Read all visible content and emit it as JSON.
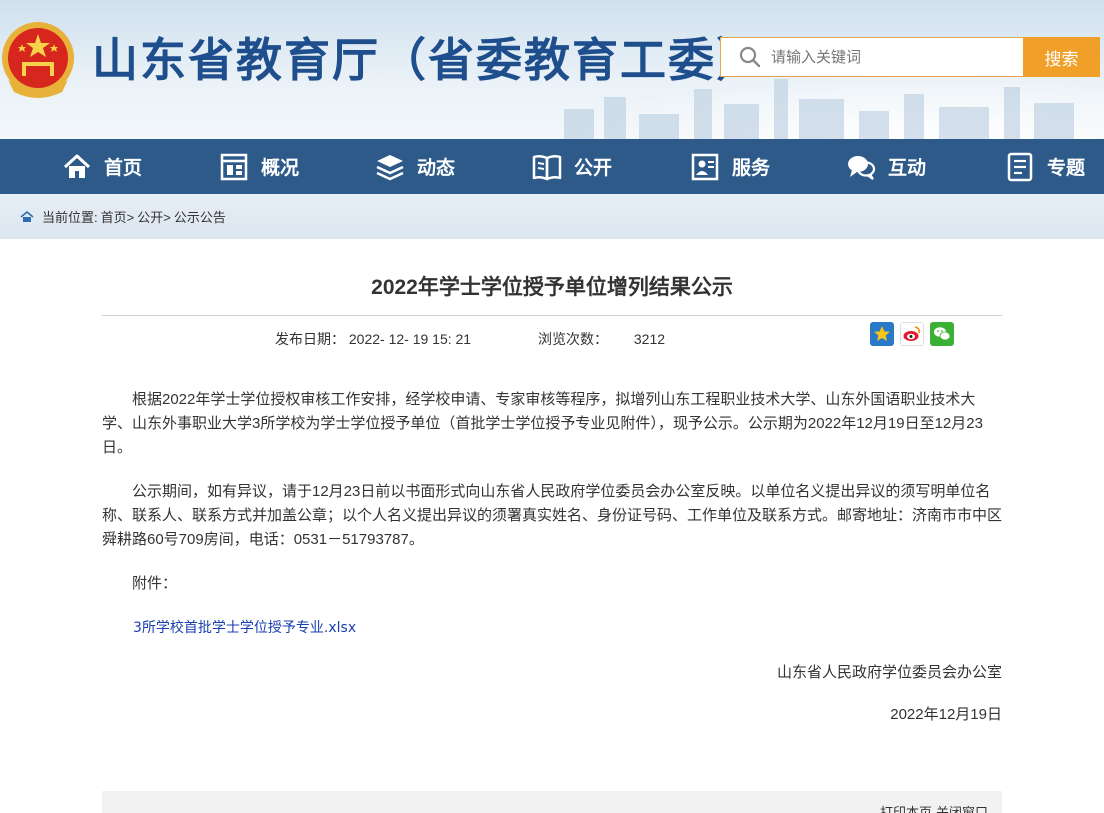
{
  "header": {
    "site_title": "山东省教育厅（省委教育工委）",
    "search_placeholder": "请输入关键词",
    "search_button": "搜索"
  },
  "nav": {
    "items": [
      {
        "label": "首页",
        "icon": "home-icon"
      },
      {
        "label": "概况",
        "icon": "overview-icon"
      },
      {
        "label": "动态",
        "icon": "news-icon"
      },
      {
        "label": "公开",
        "icon": "book-icon"
      },
      {
        "label": "服务",
        "icon": "service-icon"
      },
      {
        "label": "互动",
        "icon": "chat-icon"
      },
      {
        "label": "专题",
        "icon": "topic-icon"
      }
    ]
  },
  "breadcrumb": {
    "prefix": "当前位置:",
    "items": [
      "首页>",
      "公开>",
      "公示公告"
    ]
  },
  "article": {
    "title": "2022年学士学位授予单位增列结果公示",
    "date_label": "发布日期：",
    "date_value": "2022- 12- 19 15: 21",
    "views_label": "浏览次数：",
    "views_value": "3212",
    "paragraph1": "根据2022年学士学位授权审核工作安排，经学校申请、专家审核等程序，拟增列山东工程职业技术大学、山东外国语职业技术大学、山东外事职业大学3所学校为学士学位授予单位（首批学士学位授予专业见附件），现予公示。公示期为2022年12月19日至12月23日。",
    "paragraph2": "公示期间，如有异议，请于12月23日前以书面形式向山东省人民政府学位委员会办公室反映。以单位名义提出异议的须写明单位名称、联系人、联系方式并加盖公章；以个人名义提出异议的须署真实姓名、身份证号码、工作单位及联系方式。邮寄地址：济南市市中区舜耕路60号709房间，电话：0531－51793787。",
    "attach_label": "附件：",
    "attach_link": "3所学校首批学士学位授予专业.xlsx",
    "signature": "山东省人民政府学位委员会办公室",
    "sign_date": "2022年12月19日"
  },
  "footer": {
    "print": "打印本页",
    "close": "关闭窗口"
  },
  "colors": {
    "nav_bg": "#2e5a8a",
    "title_blue": "#1f4e8c",
    "search_orange": "#f0a028",
    "link_blue": "#1a3fb0"
  }
}
